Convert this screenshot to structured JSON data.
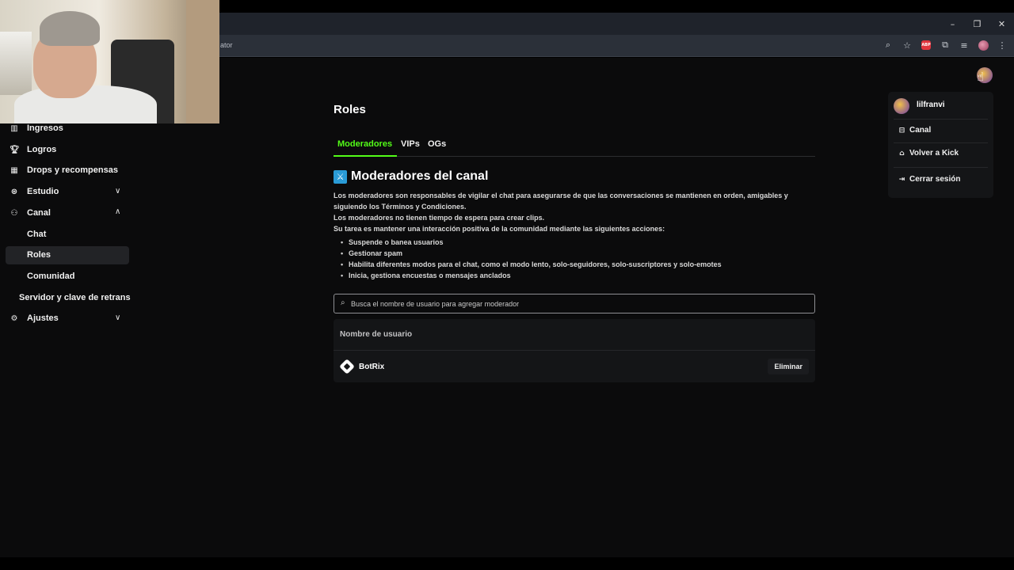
{
  "browser": {
    "omnibox_text": "ator",
    "controls": {
      "minimize": "–",
      "restore": "❐",
      "close": "✕"
    },
    "ext_abp": "ABP"
  },
  "sidebar": {
    "items": [
      {
        "label": "Ingresos",
        "icon": "bar-chart-icon"
      },
      {
        "label": "Logros",
        "icon": "trophy-icon"
      },
      {
        "label": "Drops y recompensas",
        "icon": "gift-icon"
      },
      {
        "label": "Estudio",
        "icon": "studio-icon",
        "expanded": false
      },
      {
        "label": "Canal",
        "icon": "channel-icon",
        "expanded": true
      },
      {
        "label": "Ajustes",
        "icon": "gear-icon",
        "expanded": false
      }
    ],
    "canal_sub": [
      "Chat",
      "Roles",
      "Comunidad"
    ],
    "active_sub": "Roles",
    "stream_item": "Servidor y clave de retrans"
  },
  "main": {
    "title": "Roles",
    "tabs": [
      "Moderadores",
      "VIPs",
      "OGs"
    ],
    "active_tab": "Moderadores",
    "section_title": "Moderadores del canal",
    "desc_lines": [
      "Los moderadores son responsables de vigilar el chat para asegurarse de que las conversaciones se mantienen en orden, amigables y",
      "siguiendo los Términos y Condiciones.",
      "Los moderadores no tienen tiempo de espera para crear clips.",
      "Su tarea es mantener una interacción positiva de la comunidad mediante las siguientes acciones:"
    ],
    "bullets": [
      "Suspende o banea usuarios",
      "Gestionar spam",
      "Habilita diferentes modos para el chat, como el modo lento, solo-seguidores, solo-suscriptores y solo-emotes",
      "Inicia, gestiona encuestas o mensajes anclados"
    ],
    "search_placeholder": "Busca el nombre de usuario para agregar moderador",
    "table": {
      "header": "Nombre de usuario",
      "rows": [
        {
          "username": "BotRix",
          "action": "Eliminar"
        }
      ]
    }
  },
  "user_menu": {
    "username": "lilfranvi",
    "items": [
      {
        "label": "Canal",
        "icon": "channel-icon"
      },
      {
        "label": "Volver a Kick",
        "icon": "home-icon"
      },
      {
        "label": "Cerrar sesión",
        "icon": "logout-icon"
      }
    ]
  },
  "colors": {
    "accent": "#53fc18",
    "background": "#0b0b0c",
    "panel": "#141517",
    "moderator_badge": "#2a9bd6"
  }
}
